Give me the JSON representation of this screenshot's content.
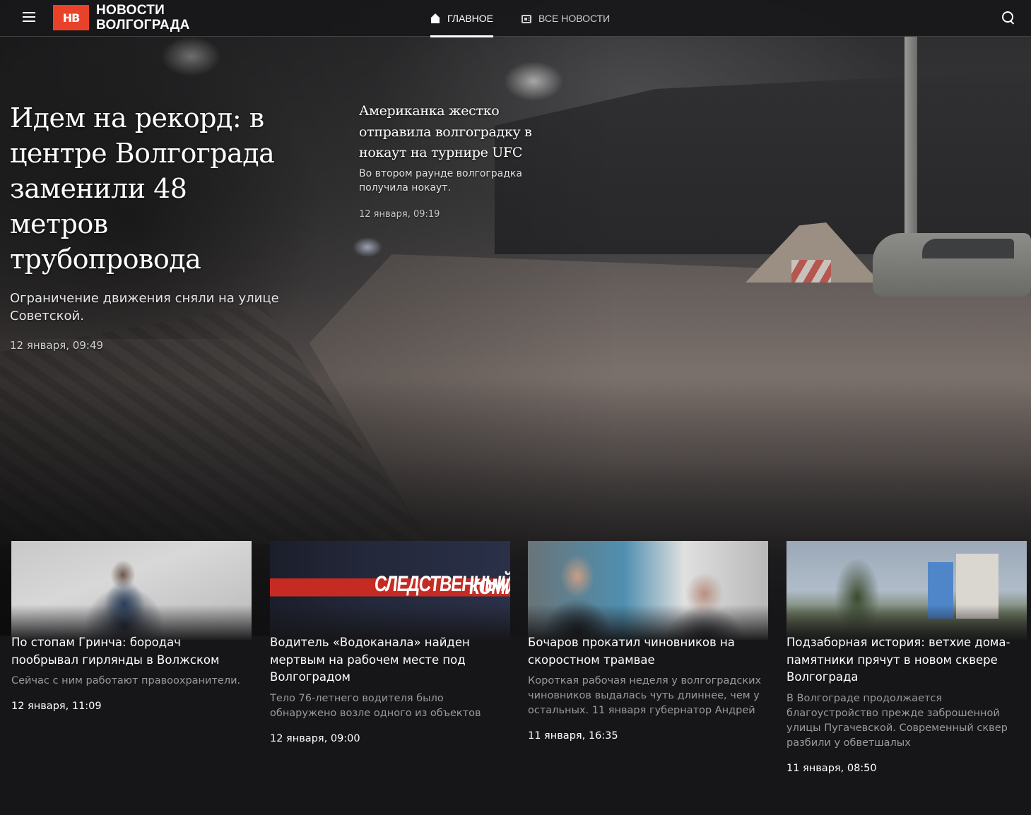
{
  "header": {
    "logo_badge": "НВ",
    "logo_line1": "НОВОСТИ",
    "logo_line2": "ВОЛГОГРАДА",
    "nav": [
      {
        "label": "ГЛАВНОЕ",
        "icon": "home-icon",
        "active": true
      },
      {
        "label": "ВСЕ НОВОСТИ",
        "icon": "newspaper-icon",
        "active": false
      }
    ]
  },
  "hero": {
    "main": {
      "title": "Идем на рекорд: в центре Волгограда заменили 48 метров трубопровода",
      "lead": "Ограничение движения сняли на улице Советской.",
      "date": "12 января, 09:49"
    },
    "side": {
      "title": "Американка жестко отправила волгоградку в нокаут на турнире UFC",
      "lead": "Во втором раунде волгоградка получила нокаут.",
      "date": "12 января, 09:19"
    }
  },
  "cards": [
    {
      "title": "По стопам Гринча: бородач пообрывал гирлянды в Волжском",
      "lead": "Сейчас с ним работают правоохранители.",
      "date": "12 января, 11:09"
    },
    {
      "title": "Водитель «Водоканала» найден мертвым на рабочем месте под Волгоградом",
      "lead": "Тело 76-летнего водителя было обнаружено возле одного из объектов",
      "date": "12 января, 09:00",
      "thumb_label_1": "СЛЕДСТВЕННЫЙ",
      "thumb_label_2": "КОМИТ"
    },
    {
      "title": "Бочаров прокатил чиновников на скоростном трамвае",
      "lead": "Короткая рабочая неделя у волгоградских чиновников выдалась чуть длиннее, чем у остальных. 11 января губернатор Андрей",
      "date": "11 января, 16:35"
    },
    {
      "title": "Подзаборная история: ветхие дома-памятники прячут в новом сквере Волгограда",
      "lead": "В Волгограде продолжается благоустройство прежде заброшенной улицы Пугачевской. Современный сквер разбили у обветшалых",
      "date": "11 января, 08:50"
    }
  ],
  "colors": {
    "brand": "#e8432a",
    "background": "#161618"
  }
}
